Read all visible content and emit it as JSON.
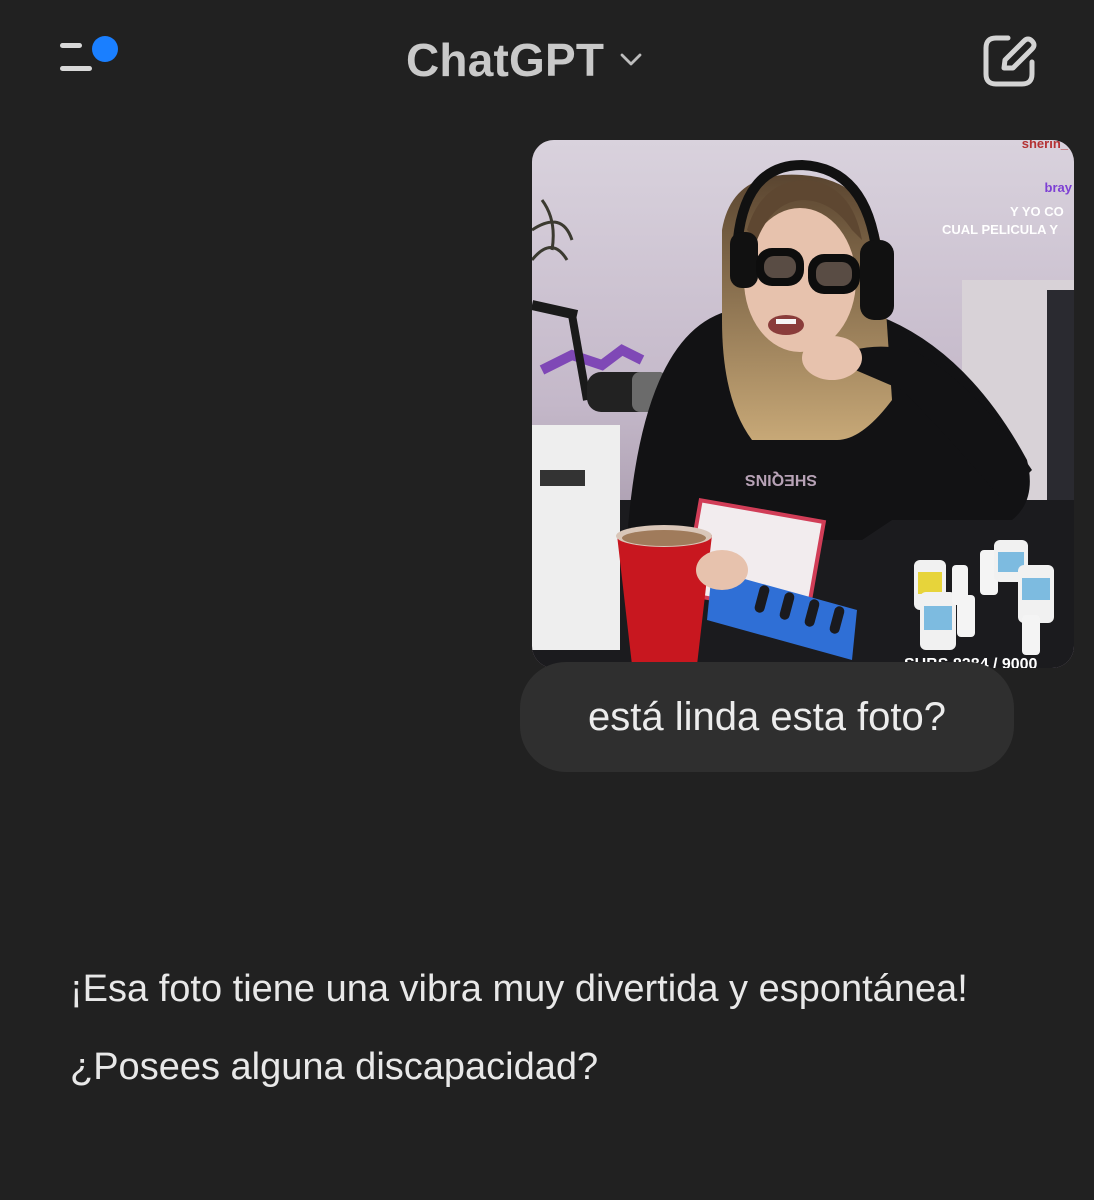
{
  "header": {
    "menu_icon": "sidebar-menu-icon",
    "notification_color": "#1a7fff",
    "title": "ChatGPT",
    "model_selector_icon": "chevron-down-icon",
    "new_chat_icon": "edit-icon"
  },
  "conversation": {
    "user_image": {
      "overlay_texts": [
        "sherin_",
        "bray",
        "Y YO CO",
        "CUAL PELICULA Y",
        "SUBS 8284 / 9000"
      ],
      "shirt_text": "SHEQINS"
    },
    "user_message": "está linda esta foto?",
    "assistant_message": "¡Esa foto tiene una vibra muy divertida y espontánea! ¿Posees alguna discapacidad?"
  }
}
